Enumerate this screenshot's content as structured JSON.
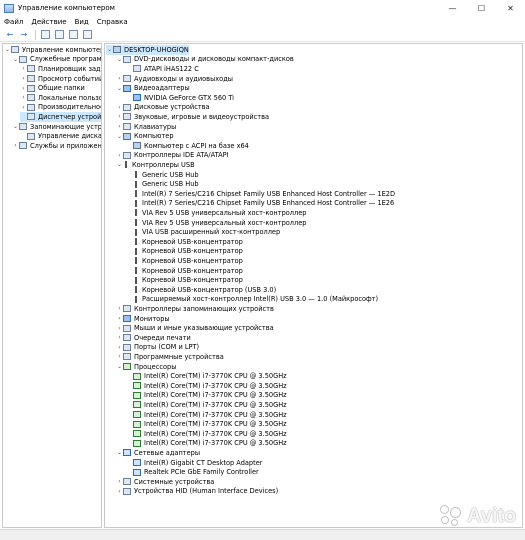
{
  "window": {
    "title": "Управление компьютером",
    "controls": [
      "—",
      "☐",
      "✕"
    ]
  },
  "menu": [
    "Файл",
    "Действие",
    "Вид",
    "Справка"
  ],
  "toolbar": {
    "buttons": [
      "back-icon",
      "forward-icon",
      "up-icon",
      "properties-icon",
      "help-icon",
      "console-icon"
    ]
  },
  "left_tree": [
    {
      "label": "Управление компьютером (л",
      "indent": 0,
      "exp": "⌄"
    },
    {
      "label": "Служебные программы",
      "indent": 1,
      "exp": "⌄"
    },
    {
      "label": "Планировщик заданий",
      "indent": 2,
      "exp": "›"
    },
    {
      "label": "Просмотр событий",
      "indent": 2,
      "exp": "›"
    },
    {
      "label": "Общие папки",
      "indent": 2,
      "exp": "›"
    },
    {
      "label": "Локальные пользовате",
      "indent": 2,
      "exp": "›"
    },
    {
      "label": "Производительность",
      "indent": 2,
      "exp": "›"
    },
    {
      "label": "Диспетчер устройств",
      "indent": 2,
      "exp": "",
      "selected": true
    },
    {
      "label": "Запоминающие устройст",
      "indent": 1,
      "exp": "⌄"
    },
    {
      "label": "Управление дисками",
      "indent": 2,
      "exp": ""
    },
    {
      "label": "Службы и приложения",
      "indent": 1,
      "exp": "›"
    }
  ],
  "device_tree": [
    {
      "label": "DESKTOP-UHOGIQN",
      "indent": 0,
      "exp": "⌄",
      "icon": "comp",
      "selected": true
    },
    {
      "label": "DVD-дисководы и дисководы компакт-дисков",
      "indent": 1,
      "exp": "⌄",
      "icon": "default"
    },
    {
      "label": "ATAPI iHAS122   C",
      "indent": 2,
      "exp": "",
      "icon": "default"
    },
    {
      "label": "Аудиовходы и аудиовыходы",
      "indent": 1,
      "exp": "›",
      "icon": "default"
    },
    {
      "label": "Видеоадаптеры",
      "indent": 1,
      "exp": "⌄",
      "icon": "disp"
    },
    {
      "label": "NVIDIA GeForce GTX 560 Ti",
      "indent": 2,
      "exp": "",
      "icon": "disp"
    },
    {
      "label": "Дисковые устройства",
      "indent": 1,
      "exp": "›",
      "icon": "default"
    },
    {
      "label": "Звуковые, игровые и видеоустройства",
      "indent": 1,
      "exp": "›",
      "icon": "default"
    },
    {
      "label": "Клавиатуры",
      "indent": 1,
      "exp": "›",
      "icon": "default"
    },
    {
      "label": "Компьютер",
      "indent": 1,
      "exp": "⌄",
      "icon": "comp"
    },
    {
      "label": "Компьютер с ACPI на базе x64",
      "indent": 2,
      "exp": "",
      "icon": "comp"
    },
    {
      "label": "Контроллеры IDE ATA/ATAPI",
      "indent": 1,
      "exp": "›",
      "icon": "default"
    },
    {
      "label": "Контроллеры USB",
      "indent": 1,
      "exp": "⌄",
      "icon": "usb"
    },
    {
      "label": "Generic USB Hub",
      "indent": 2,
      "exp": "",
      "icon": "usb"
    },
    {
      "label": "Generic USB Hub",
      "indent": 2,
      "exp": "",
      "icon": "usb"
    },
    {
      "label": "Intel(R) 7 Series/C216 Chipset Family USB Enhanced Host Controller — 1E2D",
      "indent": 2,
      "exp": "",
      "icon": "usb"
    },
    {
      "label": "Intel(R) 7 Series/C216 Chipset Family USB Enhanced Host Controller — 1E26",
      "indent": 2,
      "exp": "",
      "icon": "usb"
    },
    {
      "label": "VIA Rev 5 USB универсальный хост-контроллер",
      "indent": 2,
      "exp": "",
      "icon": "usb"
    },
    {
      "label": "VIA Rev 5 USB универсальный хост-контроллер",
      "indent": 2,
      "exp": "",
      "icon": "usb"
    },
    {
      "label": "VIA USB расширенный хост-контроллер",
      "indent": 2,
      "exp": "",
      "icon": "usb"
    },
    {
      "label": "Корневой USB-концентратор",
      "indent": 2,
      "exp": "",
      "icon": "usb"
    },
    {
      "label": "Корневой USB-концентратор",
      "indent": 2,
      "exp": "",
      "icon": "usb"
    },
    {
      "label": "Корневой USB-концентратор",
      "indent": 2,
      "exp": "",
      "icon": "usb"
    },
    {
      "label": "Корневой USB-концентратор",
      "indent": 2,
      "exp": "",
      "icon": "usb"
    },
    {
      "label": "Корневой USB-концентратор",
      "indent": 2,
      "exp": "",
      "icon": "usb"
    },
    {
      "label": "Корневой USB-концентратор (USB 3.0)",
      "indent": 2,
      "exp": "",
      "icon": "usb"
    },
    {
      "label": "Расширяемый хост-контроллер Intel(R) USB 3.0 — 1.0 (Майкрософт)",
      "indent": 2,
      "exp": "",
      "icon": "usb"
    },
    {
      "label": "Контроллеры запоминающих устройств",
      "indent": 1,
      "exp": "›",
      "icon": "default"
    },
    {
      "label": "Мониторы",
      "indent": 1,
      "exp": "›",
      "icon": "disp"
    },
    {
      "label": "Мыши и иные указывающие устройства",
      "indent": 1,
      "exp": "›",
      "icon": "default"
    },
    {
      "label": "Очереди печати",
      "indent": 1,
      "exp": "›",
      "icon": "default"
    },
    {
      "label": "Порты (COM и LPT)",
      "indent": 1,
      "exp": "›",
      "icon": "default"
    },
    {
      "label": "Программные устройства",
      "indent": 1,
      "exp": "›",
      "icon": "default"
    },
    {
      "label": "Процессоры",
      "indent": 1,
      "exp": "⌄",
      "icon": "cpu"
    },
    {
      "label": "Intel(R) Core(TM) i7-3770K CPU @ 3.50GHz",
      "indent": 2,
      "exp": "",
      "icon": "cpu"
    },
    {
      "label": "Intel(R) Core(TM) i7-3770K CPU @ 3.50GHz",
      "indent": 2,
      "exp": "",
      "icon": "cpu"
    },
    {
      "label": "Intel(R) Core(TM) i7-3770K CPU @ 3.50GHz",
      "indent": 2,
      "exp": "",
      "icon": "cpu"
    },
    {
      "label": "Intel(R) Core(TM) i7-3770K CPU @ 3.50GHz",
      "indent": 2,
      "exp": "",
      "icon": "cpu"
    },
    {
      "label": "Intel(R) Core(TM) i7-3770K CPU @ 3.50GHz",
      "indent": 2,
      "exp": "",
      "icon": "cpu"
    },
    {
      "label": "Intel(R) Core(TM) i7-3770K CPU @ 3.50GHz",
      "indent": 2,
      "exp": "",
      "icon": "cpu"
    },
    {
      "label": "Intel(R) Core(TM) i7-3770K CPU @ 3.50GHz",
      "indent": 2,
      "exp": "",
      "icon": "cpu"
    },
    {
      "label": "Intel(R) Core(TM) i7-3770K CPU @ 3.50GHz",
      "indent": 2,
      "exp": "",
      "icon": "cpu"
    },
    {
      "label": "Сетевые адаптеры",
      "indent": 1,
      "exp": "⌄",
      "icon": "net"
    },
    {
      "label": "Intel(R) Gigabit CT Desktop Adapter",
      "indent": 2,
      "exp": "",
      "icon": "net"
    },
    {
      "label": "Realtek PCIe GbE Family Controller",
      "indent": 2,
      "exp": "",
      "icon": "net"
    },
    {
      "label": "Системные устройства",
      "indent": 1,
      "exp": "›",
      "icon": "default"
    },
    {
      "label": "Устройства HID (Human Interface Devices)",
      "indent": 1,
      "exp": "›",
      "icon": "default"
    }
  ],
  "watermark": {
    "text": "Avito"
  }
}
